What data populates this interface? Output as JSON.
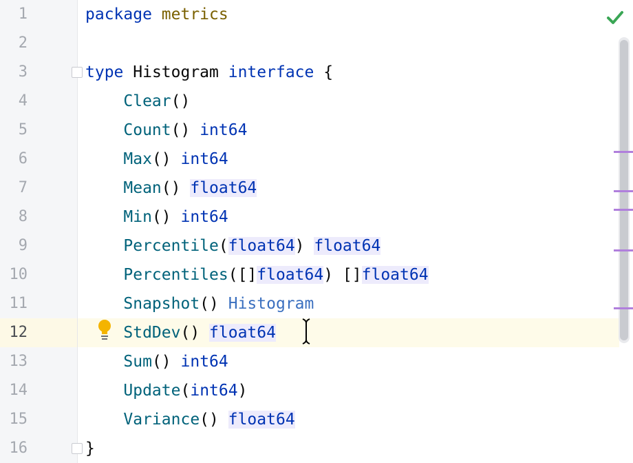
{
  "editor": {
    "status": "no-problems",
    "status_icon": "checkmark-icon",
    "accent_color": "#0033b3",
    "current_line": "12",
    "line_numbers": [
      "1",
      "2",
      "3",
      "4",
      "5",
      "6",
      "7",
      "8",
      "9",
      "10",
      "11",
      "12",
      "13",
      "14",
      "15",
      "16"
    ],
    "code": {
      "l1": {
        "kw": "package",
        "name": "metrics"
      },
      "l3": {
        "kw1": "type",
        "name": "Histogram",
        "kw2": "interface",
        "brace": "{"
      },
      "l4": {
        "fn": "Clear",
        "params": "()"
      },
      "l5": {
        "fn": "Count",
        "params": "()",
        "ret": "int64"
      },
      "l6": {
        "fn": "Max",
        "params": "()",
        "ret": "int64"
      },
      "l7": {
        "fn": "Mean",
        "params": "()",
        "ret": "float64"
      },
      "l8": {
        "fn": "Min",
        "params": "()",
        "ret": "int64"
      },
      "l9": {
        "fn": "Percentile",
        "open": "(",
        "ptype": "float64",
        "close": ")",
        "ret": "float64"
      },
      "l10": {
        "fn": "Percentiles",
        "open": "([]",
        "ptype": "float64",
        "close": ")",
        "slice": "[]",
        "ret": "float64"
      },
      "l11": {
        "fn": "Snapshot",
        "params": "()",
        "ret": "Histogram"
      },
      "l12": {
        "fn": "StdDev",
        "params": "()",
        "ret": "float64"
      },
      "l13": {
        "fn": "Sum",
        "params": "()",
        "ret": "int64"
      },
      "l14": {
        "fn": "Update",
        "open": "(",
        "ptype": "int64",
        "close": ")"
      },
      "l15": {
        "fn": "Variance",
        "params": "()",
        "ret": "float64"
      },
      "l16": {
        "brace": "}"
      }
    },
    "intention_icon": "lightbulb-icon",
    "fold_icon": "fold-marker-icon",
    "marker_color": "#b07fdc"
  }
}
